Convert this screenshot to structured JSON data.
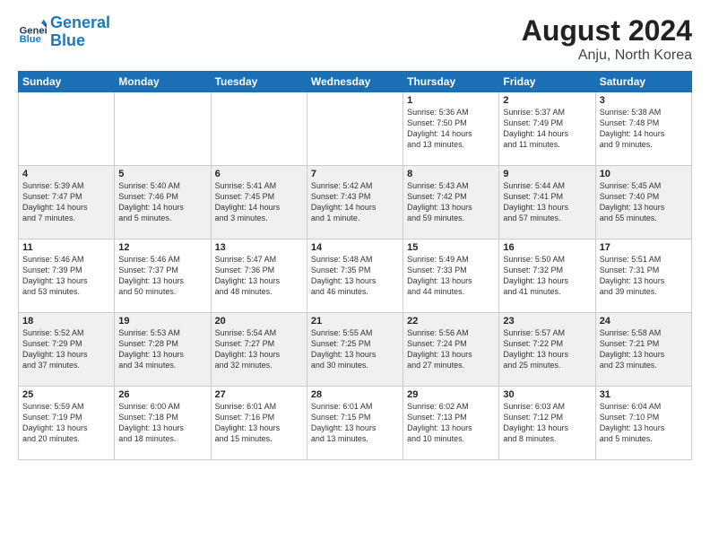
{
  "logo": {
    "line1": "General",
    "line2": "Blue"
  },
  "title": "August 2024",
  "subtitle": "Anju, North Korea",
  "days_header": [
    "Sunday",
    "Monday",
    "Tuesday",
    "Wednesday",
    "Thursday",
    "Friday",
    "Saturday"
  ],
  "weeks": [
    [
      {
        "day": "",
        "info": ""
      },
      {
        "day": "",
        "info": ""
      },
      {
        "day": "",
        "info": ""
      },
      {
        "day": "",
        "info": ""
      },
      {
        "day": "1",
        "info": "Sunrise: 5:36 AM\nSunset: 7:50 PM\nDaylight: 14 hours\nand 13 minutes."
      },
      {
        "day": "2",
        "info": "Sunrise: 5:37 AM\nSunset: 7:49 PM\nDaylight: 14 hours\nand 11 minutes."
      },
      {
        "day": "3",
        "info": "Sunrise: 5:38 AM\nSunset: 7:48 PM\nDaylight: 14 hours\nand 9 minutes."
      }
    ],
    [
      {
        "day": "4",
        "info": "Sunrise: 5:39 AM\nSunset: 7:47 PM\nDaylight: 14 hours\nand 7 minutes."
      },
      {
        "day": "5",
        "info": "Sunrise: 5:40 AM\nSunset: 7:46 PM\nDaylight: 14 hours\nand 5 minutes."
      },
      {
        "day": "6",
        "info": "Sunrise: 5:41 AM\nSunset: 7:45 PM\nDaylight: 14 hours\nand 3 minutes."
      },
      {
        "day": "7",
        "info": "Sunrise: 5:42 AM\nSunset: 7:43 PM\nDaylight: 14 hours\nand 1 minute."
      },
      {
        "day": "8",
        "info": "Sunrise: 5:43 AM\nSunset: 7:42 PM\nDaylight: 13 hours\nand 59 minutes."
      },
      {
        "day": "9",
        "info": "Sunrise: 5:44 AM\nSunset: 7:41 PM\nDaylight: 13 hours\nand 57 minutes."
      },
      {
        "day": "10",
        "info": "Sunrise: 5:45 AM\nSunset: 7:40 PM\nDaylight: 13 hours\nand 55 minutes."
      }
    ],
    [
      {
        "day": "11",
        "info": "Sunrise: 5:46 AM\nSunset: 7:39 PM\nDaylight: 13 hours\nand 53 minutes."
      },
      {
        "day": "12",
        "info": "Sunrise: 5:46 AM\nSunset: 7:37 PM\nDaylight: 13 hours\nand 50 minutes."
      },
      {
        "day": "13",
        "info": "Sunrise: 5:47 AM\nSunset: 7:36 PM\nDaylight: 13 hours\nand 48 minutes."
      },
      {
        "day": "14",
        "info": "Sunrise: 5:48 AM\nSunset: 7:35 PM\nDaylight: 13 hours\nand 46 minutes."
      },
      {
        "day": "15",
        "info": "Sunrise: 5:49 AM\nSunset: 7:33 PM\nDaylight: 13 hours\nand 44 minutes."
      },
      {
        "day": "16",
        "info": "Sunrise: 5:50 AM\nSunset: 7:32 PM\nDaylight: 13 hours\nand 41 minutes."
      },
      {
        "day": "17",
        "info": "Sunrise: 5:51 AM\nSunset: 7:31 PM\nDaylight: 13 hours\nand 39 minutes."
      }
    ],
    [
      {
        "day": "18",
        "info": "Sunrise: 5:52 AM\nSunset: 7:29 PM\nDaylight: 13 hours\nand 37 minutes."
      },
      {
        "day": "19",
        "info": "Sunrise: 5:53 AM\nSunset: 7:28 PM\nDaylight: 13 hours\nand 34 minutes."
      },
      {
        "day": "20",
        "info": "Sunrise: 5:54 AM\nSunset: 7:27 PM\nDaylight: 13 hours\nand 32 minutes."
      },
      {
        "day": "21",
        "info": "Sunrise: 5:55 AM\nSunset: 7:25 PM\nDaylight: 13 hours\nand 30 minutes."
      },
      {
        "day": "22",
        "info": "Sunrise: 5:56 AM\nSunset: 7:24 PM\nDaylight: 13 hours\nand 27 minutes."
      },
      {
        "day": "23",
        "info": "Sunrise: 5:57 AM\nSunset: 7:22 PM\nDaylight: 13 hours\nand 25 minutes."
      },
      {
        "day": "24",
        "info": "Sunrise: 5:58 AM\nSunset: 7:21 PM\nDaylight: 13 hours\nand 23 minutes."
      }
    ],
    [
      {
        "day": "25",
        "info": "Sunrise: 5:59 AM\nSunset: 7:19 PM\nDaylight: 13 hours\nand 20 minutes."
      },
      {
        "day": "26",
        "info": "Sunrise: 6:00 AM\nSunset: 7:18 PM\nDaylight: 13 hours\nand 18 minutes."
      },
      {
        "day": "27",
        "info": "Sunrise: 6:01 AM\nSunset: 7:16 PM\nDaylight: 13 hours\nand 15 minutes."
      },
      {
        "day": "28",
        "info": "Sunrise: 6:01 AM\nSunset: 7:15 PM\nDaylight: 13 hours\nand 13 minutes."
      },
      {
        "day": "29",
        "info": "Sunrise: 6:02 AM\nSunset: 7:13 PM\nDaylight: 13 hours\nand 10 minutes."
      },
      {
        "day": "30",
        "info": "Sunrise: 6:03 AM\nSunset: 7:12 PM\nDaylight: 13 hours\nand 8 minutes."
      },
      {
        "day": "31",
        "info": "Sunrise: 6:04 AM\nSunset: 7:10 PM\nDaylight: 13 hours\nand 5 minutes."
      }
    ]
  ]
}
